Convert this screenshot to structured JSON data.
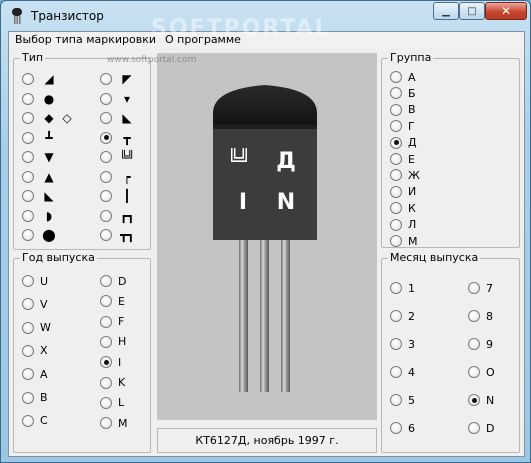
{
  "window": {
    "title": "Транзистор"
  },
  "watermark": {
    "text": "SOFTPORTAL",
    "sub": "www.softportal.com"
  },
  "menu": [
    "Выбор типа маркировки",
    "О программе"
  ],
  "type_group": {
    "legend": "Тип",
    "selected_index": 12,
    "items": [
      {
        "symbol": "◢",
        "extra": ""
      },
      {
        "symbol": "●",
        "extra": ""
      },
      {
        "symbol": "◆",
        "extra": "◇"
      },
      {
        "symbol": "┻",
        "extra": ""
      },
      {
        "symbol": "▼",
        "extra": ""
      },
      {
        "symbol": "▲",
        "extra": ""
      },
      {
        "symbol": "◣",
        "extra": ""
      },
      {
        "symbol": "◗",
        "extra": ""
      },
      {
        "symbol": "⬤",
        "extra": ""
      },
      {
        "symbol": "◤",
        "extra": ""
      },
      {
        "symbol": "▾",
        "extra": ""
      },
      {
        "symbol": "◣",
        "extra": ""
      },
      {
        "symbol": "┳",
        "extra": ""
      },
      {
        "symbol": "╚╝",
        "extra": ""
      },
      {
        "symbol": "┍",
        "extra": ""
      },
      {
        "symbol": "┃",
        "extra": ""
      },
      {
        "symbol": "┏┓",
        "extra": ""
      },
      {
        "symbol": "┳┓",
        "extra": ""
      }
    ]
  },
  "year_group": {
    "legend": "Год выпуска",
    "selected": "I",
    "left": [
      "U",
      "V",
      "W",
      "X",
      "A",
      "B",
      "C"
    ],
    "right": [
      "D",
      "E",
      "F",
      "H",
      "I",
      "K",
      "L",
      "M"
    ]
  },
  "group_group": {
    "legend": "Группа",
    "selected": "Д",
    "items": [
      "А",
      "Б",
      "В",
      "Г",
      "Д",
      "Е",
      "Ж",
      "И",
      "К",
      "Л",
      "М"
    ]
  },
  "month_group": {
    "legend": "Месяц выпуска",
    "selected": "N",
    "left": [
      "1",
      "2",
      "3",
      "4",
      "5",
      "6"
    ],
    "right": [
      "7",
      "8",
      "9",
      "O",
      "N",
      "D"
    ]
  },
  "transistor": {
    "marks": [
      "╚╝",
      "Д",
      "I",
      "N"
    ]
  },
  "caption": "КТ6127Д, ноябрь 1997 г.",
  "colors": {
    "body": "#3a3a3a",
    "top": "#1c1c1c",
    "marking": "#ffffff",
    "preview_bg": "#c4c4c4"
  }
}
